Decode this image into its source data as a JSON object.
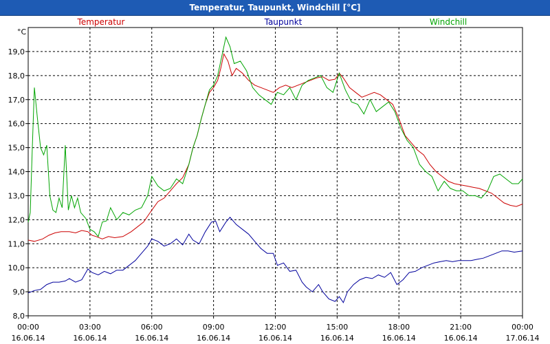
{
  "window": {
    "title": "Temperatur, Taupunkt, Windchill [°C]"
  },
  "chart_data": {
    "type": "line",
    "unit_label": "°C",
    "ylim": [
      8.0,
      20.0
    ],
    "y_ticks": [
      "19,0",
      "18,0",
      "17,0",
      "16,0",
      "15,0",
      "14,0",
      "13,0",
      "12,0",
      "11,0",
      "10,0",
      "9,0",
      "8,0"
    ],
    "y_tick_values": [
      19,
      18,
      17,
      16,
      15,
      14,
      13,
      12,
      11,
      10,
      9,
      8
    ],
    "x_ticks": [
      {
        "time": "00:00",
        "date": "16.06.14",
        "hours": 0
      },
      {
        "time": "03:00",
        "date": "16.06.14",
        "hours": 3
      },
      {
        "time": "06:00",
        "date": "16.06.14",
        "hours": 6
      },
      {
        "time": "09:00",
        "date": "16.06.14",
        "hours": 9
      },
      {
        "time": "12:00",
        "date": "16.06.14",
        "hours": 12
      },
      {
        "time": "15:00",
        "date": "16.06.14",
        "hours": 15
      },
      {
        "time": "18:00",
        "date": "16.06.14",
        "hours": 18
      },
      {
        "time": "21:00",
        "date": "16.06.14",
        "hours": 21
      },
      {
        "time": "00:00",
        "date": "17.06.14",
        "hours": 24
      }
    ],
    "xlim": [
      0,
      24
    ],
    "grid": true,
    "series": [
      {
        "name": "Temperatur",
        "color": "#cc0000",
        "points": [
          [
            0.0,
            11.15
          ],
          [
            0.3,
            11.1
          ],
          [
            0.7,
            11.2
          ],
          [
            1.0,
            11.35
          ],
          [
            1.3,
            11.45
          ],
          [
            1.6,
            11.5
          ],
          [
            2.0,
            11.5
          ],
          [
            2.3,
            11.45
          ],
          [
            2.6,
            11.55
          ],
          [
            2.9,
            11.5
          ],
          [
            3.1,
            11.35
          ],
          [
            3.3,
            11.3
          ],
          [
            3.6,
            11.2
          ],
          [
            3.9,
            11.3
          ],
          [
            4.2,
            11.25
          ],
          [
            4.6,
            11.3
          ],
          [
            5.0,
            11.5
          ],
          [
            5.3,
            11.7
          ],
          [
            5.6,
            11.9
          ],
          [
            6.0,
            12.4
          ],
          [
            6.3,
            12.75
          ],
          [
            6.6,
            12.9
          ],
          [
            6.9,
            13.2
          ],
          [
            7.2,
            13.5
          ],
          [
            7.5,
            13.75
          ],
          [
            7.8,
            14.3
          ],
          [
            8.0,
            15.0
          ],
          [
            8.2,
            15.5
          ],
          [
            8.4,
            16.2
          ],
          [
            8.6,
            16.8
          ],
          [
            8.8,
            17.3
          ],
          [
            9.0,
            17.5
          ],
          [
            9.2,
            17.8
          ],
          [
            9.35,
            18.3
          ],
          [
            9.5,
            18.9
          ],
          [
            9.7,
            18.6
          ],
          [
            9.9,
            18.0
          ],
          [
            10.1,
            18.3
          ],
          [
            10.4,
            18.1
          ],
          [
            10.7,
            17.8
          ],
          [
            11.0,
            17.6
          ],
          [
            11.3,
            17.5
          ],
          [
            11.6,
            17.4
          ],
          [
            11.9,
            17.3
          ],
          [
            12.2,
            17.5
          ],
          [
            12.5,
            17.6
          ],
          [
            12.8,
            17.5
          ],
          [
            13.1,
            17.6
          ],
          [
            13.4,
            17.7
          ],
          [
            13.7,
            17.8
          ],
          [
            14.0,
            17.9
          ],
          [
            14.3,
            17.95
          ],
          [
            14.6,
            17.8
          ],
          [
            14.9,
            17.85
          ],
          [
            15.1,
            18.1
          ],
          [
            15.3,
            17.9
          ],
          [
            15.6,
            17.5
          ],
          [
            15.9,
            17.3
          ],
          [
            16.2,
            17.1
          ],
          [
            16.5,
            17.2
          ],
          [
            16.8,
            17.3
          ],
          [
            17.1,
            17.2
          ],
          [
            17.4,
            17.0
          ],
          [
            17.7,
            16.8
          ],
          [
            18.0,
            16.2
          ],
          [
            18.3,
            15.5
          ],
          [
            18.6,
            15.2
          ],
          [
            18.9,
            14.9
          ],
          [
            19.2,
            14.7
          ],
          [
            19.5,
            14.3
          ],
          [
            19.8,
            14.0
          ],
          [
            20.1,
            13.8
          ],
          [
            20.4,
            13.6
          ],
          [
            20.7,
            13.5
          ],
          [
            21.0,
            13.45
          ],
          [
            21.3,
            13.4
          ],
          [
            21.6,
            13.35
          ],
          [
            21.9,
            13.3
          ],
          [
            22.2,
            13.2
          ],
          [
            22.5,
            13.1
          ],
          [
            22.8,
            12.9
          ],
          [
            23.1,
            12.7
          ],
          [
            23.4,
            12.6
          ],
          [
            23.7,
            12.55
          ],
          [
            24.0,
            12.65
          ]
        ]
      },
      {
        "name": "Taupunkt",
        "color": "#00009c",
        "points": [
          [
            0.0,
            8.95
          ],
          [
            0.3,
            9.05
          ],
          [
            0.6,
            9.1
          ],
          [
            0.9,
            9.3
          ],
          [
            1.2,
            9.4
          ],
          [
            1.5,
            9.4
          ],
          [
            1.8,
            9.45
          ],
          [
            2.0,
            9.55
          ],
          [
            2.3,
            9.4
          ],
          [
            2.6,
            9.5
          ],
          [
            2.9,
            9.95
          ],
          [
            3.1,
            9.8
          ],
          [
            3.4,
            9.7
          ],
          [
            3.7,
            9.85
          ],
          [
            4.0,
            9.75
          ],
          [
            4.3,
            9.9
          ],
          [
            4.6,
            9.9
          ],
          [
            4.9,
            10.1
          ],
          [
            5.2,
            10.3
          ],
          [
            5.5,
            10.6
          ],
          [
            5.8,
            10.9
          ],
          [
            6.0,
            11.2
          ],
          [
            6.3,
            11.1
          ],
          [
            6.6,
            10.9
          ],
          [
            6.9,
            11.0
          ],
          [
            7.2,
            11.2
          ],
          [
            7.5,
            10.95
          ],
          [
            7.8,
            11.4
          ],
          [
            8.0,
            11.15
          ],
          [
            8.3,
            11.0
          ],
          [
            8.6,
            11.5
          ],
          [
            8.9,
            11.9
          ],
          [
            9.1,
            11.95
          ],
          [
            9.3,
            11.5
          ],
          [
            9.6,
            11.9
          ],
          [
            9.8,
            12.1
          ],
          [
            10.1,
            11.8
          ],
          [
            10.4,
            11.6
          ],
          [
            10.7,
            11.4
          ],
          [
            11.0,
            11.1
          ],
          [
            11.3,
            10.8
          ],
          [
            11.6,
            10.6
          ],
          [
            11.9,
            10.6
          ],
          [
            12.1,
            10.1
          ],
          [
            12.4,
            10.2
          ],
          [
            12.7,
            9.85
          ],
          [
            13.0,
            9.9
          ],
          [
            13.3,
            9.4
          ],
          [
            13.5,
            9.2
          ],
          [
            13.8,
            9.0
          ],
          [
            14.1,
            9.3
          ],
          [
            14.3,
            9.0
          ],
          [
            14.6,
            8.7
          ],
          [
            14.9,
            8.6
          ],
          [
            15.1,
            8.8
          ],
          [
            15.3,
            8.55
          ],
          [
            15.5,
            9.0
          ],
          [
            15.8,
            9.3
          ],
          [
            16.1,
            9.5
          ],
          [
            16.4,
            9.6
          ],
          [
            16.7,
            9.55
          ],
          [
            17.0,
            9.7
          ],
          [
            17.3,
            9.6
          ],
          [
            17.6,
            9.8
          ],
          [
            17.9,
            9.3
          ],
          [
            18.2,
            9.5
          ],
          [
            18.5,
            9.8
          ],
          [
            18.8,
            9.85
          ],
          [
            19.1,
            10.0
          ],
          [
            19.4,
            10.1
          ],
          [
            19.7,
            10.2
          ],
          [
            20.0,
            10.25
          ],
          [
            20.3,
            10.3
          ],
          [
            20.6,
            10.25
          ],
          [
            20.9,
            10.3
          ],
          [
            21.2,
            10.3
          ],
          [
            21.5,
            10.3
          ],
          [
            21.8,
            10.35
          ],
          [
            22.1,
            10.4
          ],
          [
            22.4,
            10.5
          ],
          [
            22.7,
            10.6
          ],
          [
            23.0,
            10.7
          ],
          [
            23.3,
            10.7
          ],
          [
            23.6,
            10.65
          ],
          [
            24.0,
            10.7
          ]
        ]
      },
      {
        "name": "Windchill",
        "color": "#00a400",
        "points": [
          [
            0.0,
            11.9
          ],
          [
            0.1,
            12.3
          ],
          [
            0.2,
            15.0
          ],
          [
            0.3,
            17.5
          ],
          [
            0.45,
            16.2
          ],
          [
            0.6,
            15.0
          ],
          [
            0.75,
            14.7
          ],
          [
            0.9,
            15.1
          ],
          [
            1.05,
            13.0
          ],
          [
            1.2,
            12.4
          ],
          [
            1.35,
            12.3
          ],
          [
            1.5,
            12.9
          ],
          [
            1.65,
            12.5
          ],
          [
            1.8,
            15.1
          ],
          [
            1.95,
            12.4
          ],
          [
            2.1,
            13.0
          ],
          [
            2.25,
            12.5
          ],
          [
            2.4,
            12.9
          ],
          [
            2.55,
            12.3
          ],
          [
            2.8,
            12.05
          ],
          [
            3.0,
            11.6
          ],
          [
            3.2,
            11.5
          ],
          [
            3.4,
            11.3
          ],
          [
            3.6,
            11.9
          ],
          [
            3.8,
            11.95
          ],
          [
            4.0,
            12.5
          ],
          [
            4.3,
            12.0
          ],
          [
            4.6,
            12.3
          ],
          [
            4.9,
            12.2
          ],
          [
            5.2,
            12.4
          ],
          [
            5.5,
            12.5
          ],
          [
            5.8,
            13.0
          ],
          [
            6.0,
            13.8
          ],
          [
            6.3,
            13.4
          ],
          [
            6.6,
            13.2
          ],
          [
            6.9,
            13.3
          ],
          [
            7.2,
            13.7
          ],
          [
            7.5,
            13.5
          ],
          [
            7.8,
            14.3
          ],
          [
            8.0,
            15.0
          ],
          [
            8.2,
            15.5
          ],
          [
            8.4,
            16.2
          ],
          [
            8.6,
            16.8
          ],
          [
            8.8,
            17.4
          ],
          [
            9.0,
            17.6
          ],
          [
            9.2,
            18.0
          ],
          [
            9.4,
            18.8
          ],
          [
            9.6,
            19.6
          ],
          [
            9.8,
            19.2
          ],
          [
            10.0,
            18.5
          ],
          [
            10.3,
            18.6
          ],
          [
            10.6,
            18.2
          ],
          [
            10.9,
            17.5
          ],
          [
            11.2,
            17.2
          ],
          [
            11.5,
            17.0
          ],
          [
            11.8,
            16.8
          ],
          [
            12.1,
            17.3
          ],
          [
            12.4,
            17.2
          ],
          [
            12.7,
            17.5
          ],
          [
            13.0,
            17.0
          ],
          [
            13.3,
            17.6
          ],
          [
            13.6,
            17.8
          ],
          [
            13.9,
            17.9
          ],
          [
            14.2,
            18.0
          ],
          [
            14.5,
            17.5
          ],
          [
            14.8,
            17.3
          ],
          [
            15.1,
            18.1
          ],
          [
            15.4,
            17.4
          ],
          [
            15.7,
            16.9
          ],
          [
            16.0,
            16.8
          ],
          [
            16.3,
            16.4
          ],
          [
            16.6,
            17.0
          ],
          [
            16.9,
            16.5
          ],
          [
            17.2,
            16.7
          ],
          [
            17.5,
            16.9
          ],
          [
            17.8,
            16.5
          ],
          [
            18.1,
            15.8
          ],
          [
            18.4,
            15.3
          ],
          [
            18.7,
            15.0
          ],
          [
            19.0,
            14.3
          ],
          [
            19.3,
            14.0
          ],
          [
            19.6,
            13.8
          ],
          [
            19.9,
            13.2
          ],
          [
            20.2,
            13.6
          ],
          [
            20.5,
            13.3
          ],
          [
            20.8,
            13.2
          ],
          [
            21.1,
            13.2
          ],
          [
            21.4,
            13.0
          ],
          [
            21.7,
            13.0
          ],
          [
            22.0,
            12.9
          ],
          [
            22.3,
            13.2
          ],
          [
            22.6,
            13.8
          ],
          [
            22.9,
            13.9
          ],
          [
            23.2,
            13.7
          ],
          [
            23.5,
            13.5
          ],
          [
            23.8,
            13.5
          ],
          [
            24.0,
            13.7
          ]
        ]
      }
    ]
  }
}
